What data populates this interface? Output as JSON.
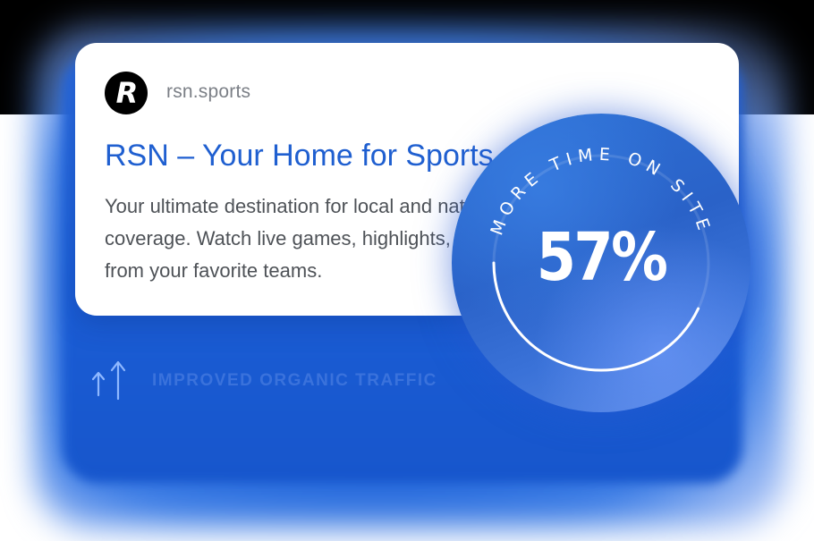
{
  "result": {
    "site": "rsn.sports",
    "logo_letter": "R",
    "title": "RSN – Your Home for Sports",
    "description": "Your ultimate destination for local and national sports coverage. Watch live games, highlights, and news from your favorite teams."
  },
  "stat": {
    "label": "IMPROVED ORGANIC TRAFFIC",
    "icon": "up-arrows-icon"
  },
  "badge": {
    "label": "MORE TIME ON SITE",
    "value": "57%",
    "progress": 0.57
  },
  "colors": {
    "title_blue": "#1f5fd0",
    "glow_blue": "#1b5ed6",
    "badge_blue": "#2e72d6"
  }
}
